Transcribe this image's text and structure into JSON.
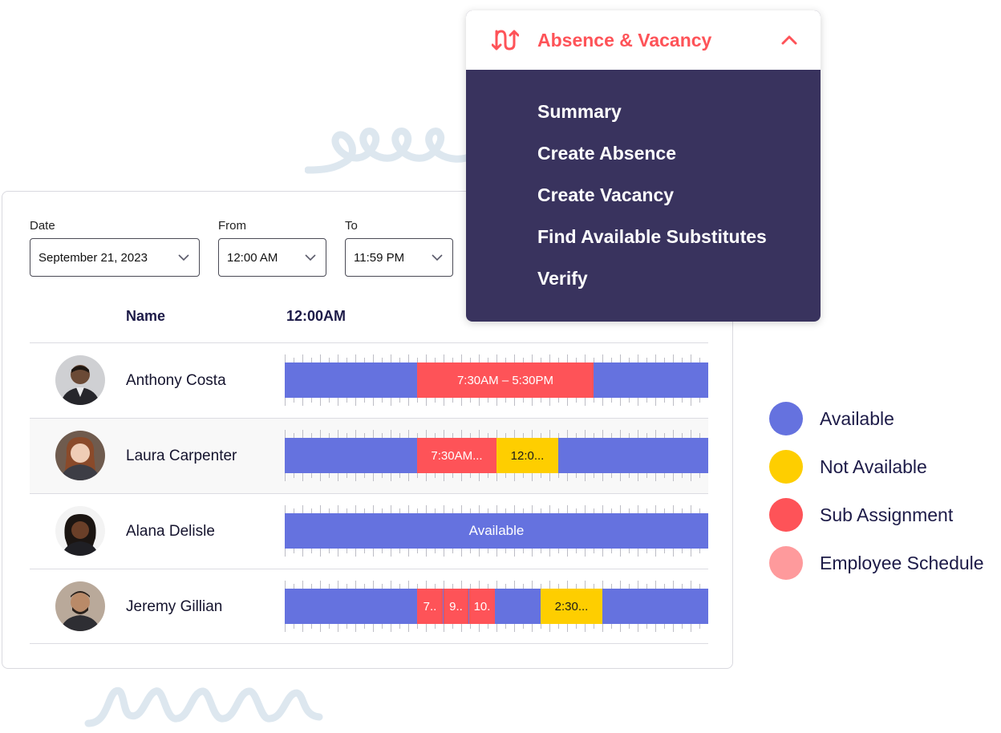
{
  "filters": {
    "date": {
      "label": "Date",
      "value": "September 21, 2023"
    },
    "from": {
      "label": "From",
      "value": "12:00 AM"
    },
    "to": {
      "label": "To",
      "value": "11:59 PM"
    }
  },
  "table": {
    "name_header": "Name",
    "time_header": "12:00AM",
    "rows": [
      {
        "name": "Anthony Costa",
        "segments": [
          {
            "label": "7:30AM – 5:30PM",
            "status": "sub-assignment"
          }
        ]
      },
      {
        "name": "Laura Carpenter",
        "segments": [
          {
            "label": "7:30AM...",
            "status": "sub-assignment"
          },
          {
            "label": "12:0...",
            "status": "not-available"
          }
        ]
      },
      {
        "name": "Alana Delisle",
        "bar_label": "Available"
      },
      {
        "name": "Jeremy Gillian",
        "segments": [
          {
            "label": "7..",
            "status": "sub-assignment"
          },
          {
            "label": "9..",
            "status": "sub-assignment"
          },
          {
            "label": "10.",
            "status": "sub-assignment"
          },
          {
            "label": "2:30...",
            "status": "not-available"
          }
        ]
      }
    ]
  },
  "menu": {
    "title": "Absence & Vacancy",
    "icon": "swap-arrows-icon",
    "items": [
      "Summary",
      "Create Absence",
      "Create Vacancy",
      "Find Available Substitutes",
      "Verify"
    ]
  },
  "legend": [
    {
      "label": "Available",
      "color": "#6572df"
    },
    {
      "label": "Not Available",
      "color": "#fece00"
    },
    {
      "label": "Sub Assignment",
      "color": "#fe5358"
    },
    {
      "label": "Employee Schedule",
      "color": "#fe9a9c"
    }
  ],
  "colors": {
    "available": "#6572df",
    "not_available": "#fece00",
    "sub_assignment": "#fe5358",
    "menu_bg": "#39335e",
    "accent": "#fe5358"
  }
}
